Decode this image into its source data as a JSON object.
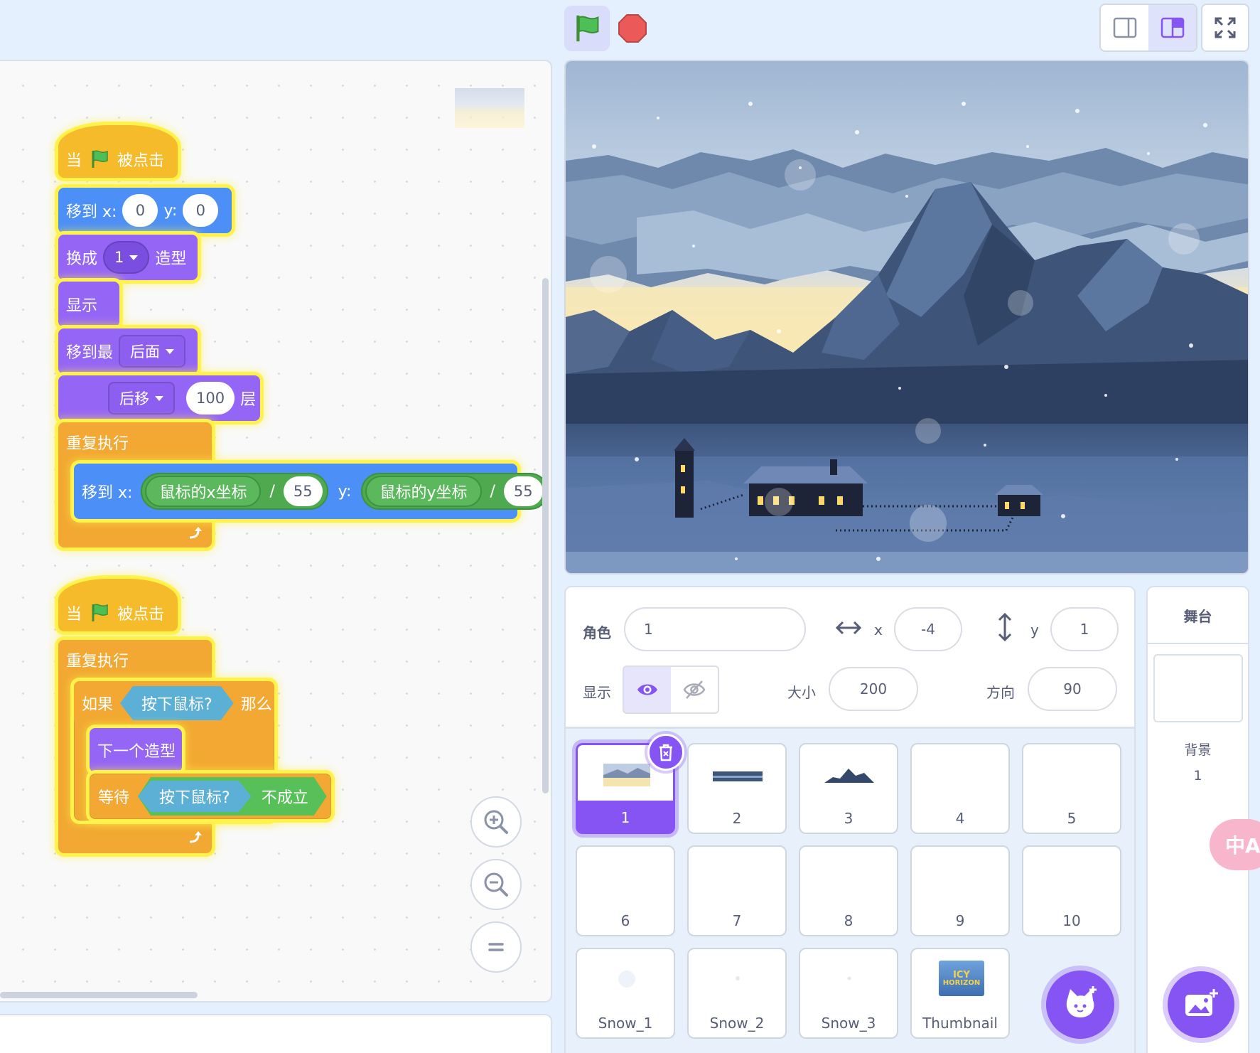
{
  "scripts": {
    "script1": {
      "hat": {
        "when": "当",
        "clicked": "被点击"
      },
      "goto": {
        "label": "移到 x:",
        "x": "0",
        "y_label": "y:",
        "y": "0"
      },
      "switch_costume": {
        "label": "换成",
        "value": "1",
        "suffix": "造型"
      },
      "show": "显示",
      "goto_layer": {
        "label": "移到最",
        "value": "后面"
      },
      "go_layers": {
        "direction": "后移",
        "count": "100",
        "suffix": "层"
      },
      "forever": "重复执行",
      "goto_mouse": {
        "label": "移到 x:",
        "mouse_x": "鼠标的x坐标",
        "div": "/",
        "divisor_x": "55",
        "y_label": "y:",
        "mouse_y": "鼠标的y坐标",
        "divisor_y": "55"
      }
    },
    "script2": {
      "hat": {
        "when": "当",
        "clicked": "被点击"
      },
      "forever": "重复执行",
      "if": {
        "label": "如果",
        "condition": "按下鼠标?",
        "then": "那么"
      },
      "next_costume": "下一个造型",
      "wait_until": {
        "label": "等待",
        "condition": "按下鼠标?",
        "not": "不成立"
      }
    }
  },
  "sprite_info": {
    "sprite_label": "角色",
    "sprite_name": "1",
    "x_label": "x",
    "x": "-4",
    "y_label": "y",
    "y": "1",
    "show_label": "显示",
    "size_label": "大小",
    "size": "200",
    "direction_label": "方向",
    "direction": "90"
  },
  "costumes": [
    {
      "num": "1",
      "selected": true
    },
    {
      "num": "2"
    },
    {
      "num": "3"
    },
    {
      "num": "4"
    },
    {
      "num": "5"
    },
    {
      "num": "6"
    },
    {
      "num": "7"
    },
    {
      "num": "8"
    },
    {
      "num": "9"
    },
    {
      "num": "10"
    },
    {
      "num": "Snow_1"
    },
    {
      "num": "Snow_2"
    },
    {
      "num": "Snow_3"
    },
    {
      "num": "Thumbnail"
    }
  ],
  "stage_panel": {
    "title": "舞台",
    "backdrop_label": "背景",
    "backdrop_count": "1"
  },
  "thumbnail_text": {
    "line1": "ICY",
    "line2": "HORIZON"
  },
  "translate_badge": "中A",
  "colors": {
    "events": "#f5bb2a",
    "motion": "#4c8ff6",
    "looks": "#9565f6",
    "control": "#f2a832",
    "sensing": "#5cb0d6",
    "operators": "#58c059",
    "accent": "#8554f3"
  }
}
